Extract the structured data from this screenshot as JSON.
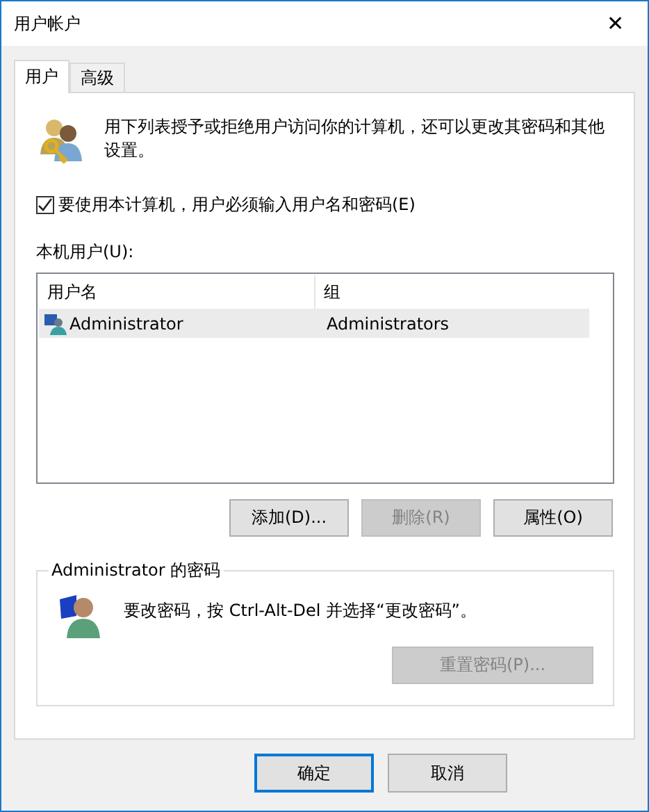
{
  "window": {
    "title": "用户帐户",
    "close": "✕"
  },
  "tabs": [
    {
      "label": "用户",
      "selected": true
    },
    {
      "label": "高级",
      "selected": false
    }
  ],
  "intro": "用下列表授予或拒绝用户访问你的计算机，还可以更改其密码和其他设置。",
  "require_login": {
    "label": "要使用本计算机，用户必须输入用户名和密码(E)",
    "checked": true
  },
  "users_label": "本机用户(U):",
  "table": {
    "columns": [
      "用户名",
      "组"
    ],
    "rows": [
      {
        "cells": [
          "Administrator",
          "Administrators"
        ],
        "selected": true
      }
    ]
  },
  "user_buttons": [
    {
      "label": "添加(D)...",
      "disabled": false
    },
    {
      "label": "删除(R)",
      "disabled": true
    },
    {
      "label": "属性(O)",
      "disabled": false
    }
  ],
  "password_group": {
    "title": "Administrator 的密码",
    "text": "要改密码，按 Ctrl-Alt-Del 并选择“更改密码”。",
    "button": {
      "label": "重置密码(P)...",
      "disabled": true
    }
  },
  "dialog_buttons": [
    {
      "label": "确定",
      "default": true
    },
    {
      "label": "取消",
      "default": false
    }
  ]
}
